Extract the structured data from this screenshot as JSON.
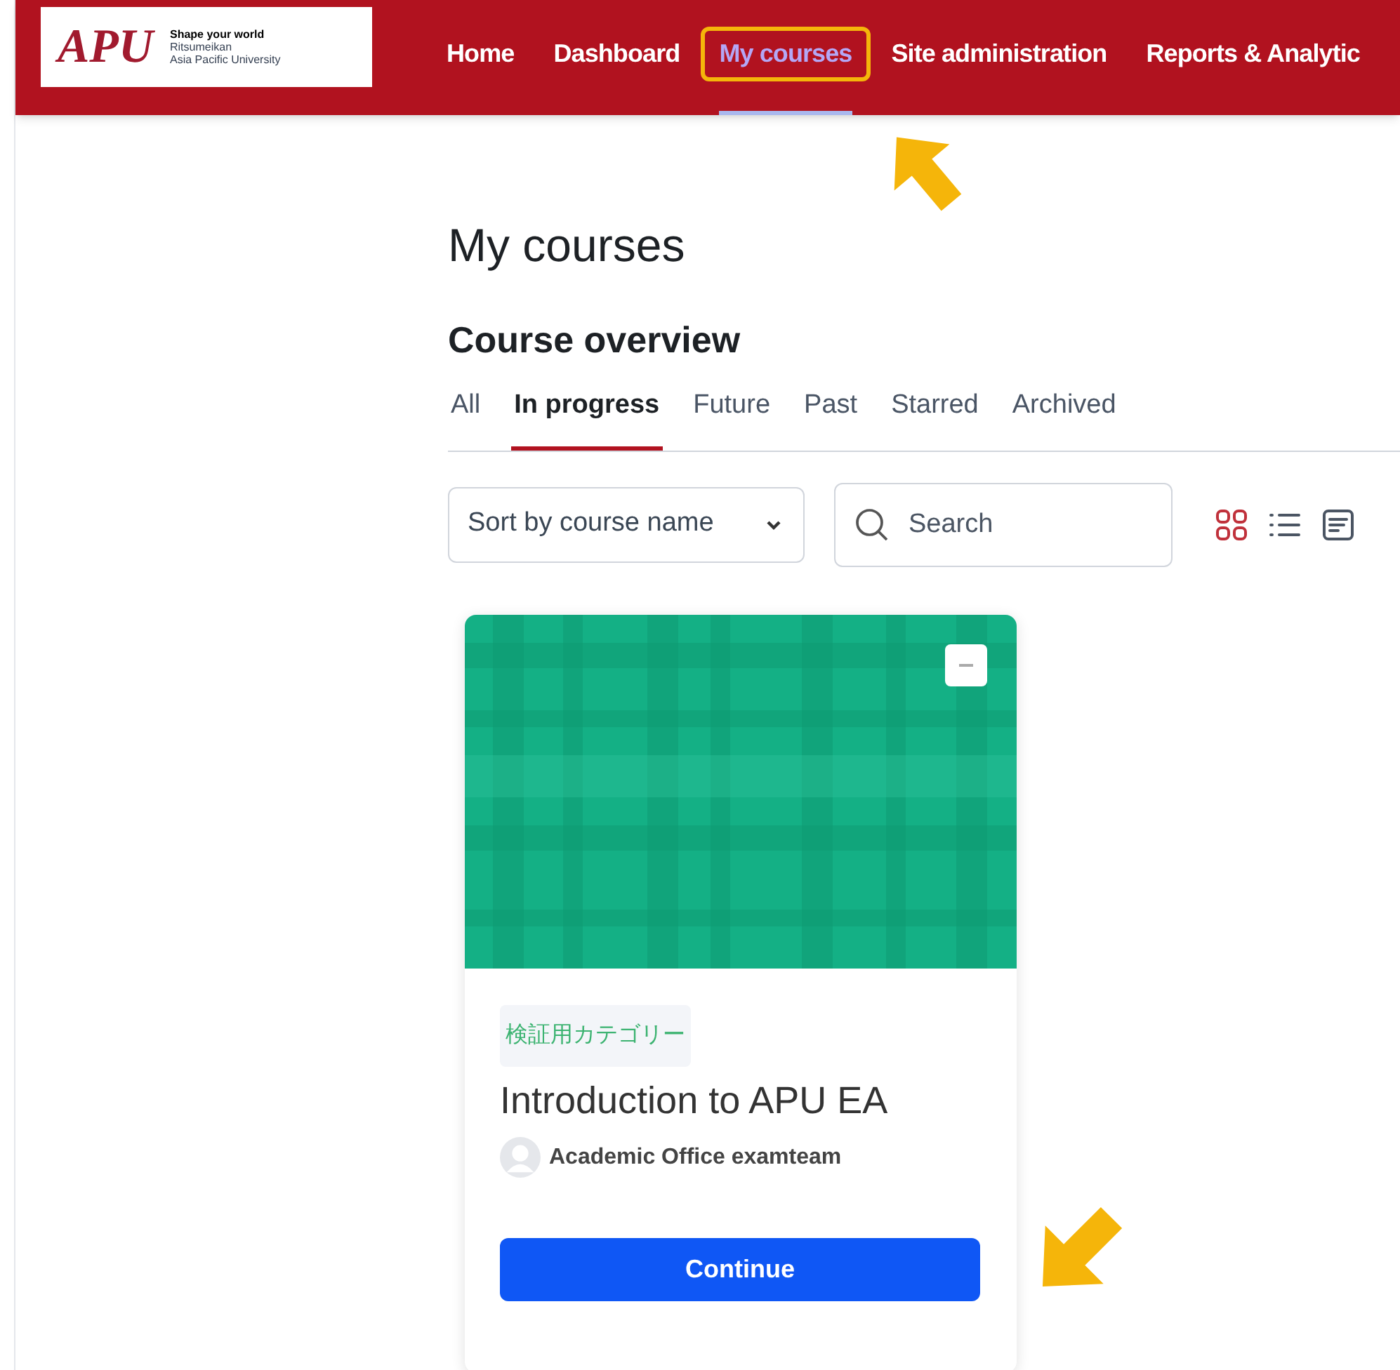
{
  "header": {
    "logo": {
      "mark": "APU",
      "tagline": "Shape your world",
      "name_line_1": "Ritsumeikan",
      "name_line_2": "Asia Pacific University"
    },
    "nav": [
      {
        "label": "Home",
        "selected": false,
        "highlighted": false
      },
      {
        "label": "Dashboard",
        "selected": false,
        "highlighted": false
      },
      {
        "label": "My courses",
        "selected": true,
        "highlighted": true
      },
      {
        "label": "Site administration",
        "selected": false,
        "highlighted": false
      },
      {
        "label": "Reports & Analytic",
        "selected": false,
        "highlighted": false
      }
    ]
  },
  "page_title": "My courses",
  "section_title": "Course overview",
  "tabs": [
    {
      "label": "All",
      "selected": false
    },
    {
      "label": "In progress",
      "selected": true
    },
    {
      "label": "Future",
      "selected": false
    },
    {
      "label": "Past",
      "selected": false
    },
    {
      "label": "Starred",
      "selected": false
    },
    {
      "label": "Archived",
      "selected": false
    }
  ],
  "sort_select": {
    "value": "Sort by course name"
  },
  "search": {
    "placeholder": "Search"
  },
  "views": [
    {
      "kind": "card",
      "selected": true
    },
    {
      "kind": "list",
      "selected": false
    },
    {
      "kind": "summary",
      "selected": false
    }
  ],
  "courses": [
    {
      "category": "検証用カテゴリー",
      "title": "Introduction to APU EA",
      "teacher": "Academic Office examteam",
      "button": "Continue"
    }
  ]
}
